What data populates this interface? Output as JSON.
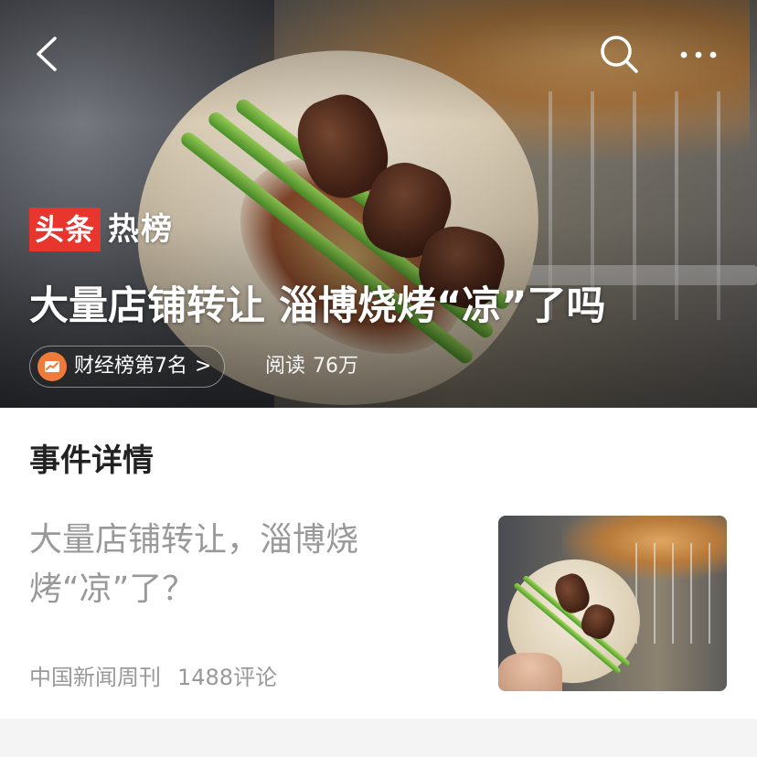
{
  "nav": {
    "back_icon": "chevron-left-icon",
    "search_icon": "search-icon",
    "more_icon": "more-horizontal-icon"
  },
  "hero": {
    "brand_red": "头条",
    "brand_white": "热榜",
    "title": "大量店铺转让 淄博烧烤“凉”了吗",
    "rank_label": "财经榜第7名",
    "rank_arrow": ">",
    "read_label": "阅读",
    "read_value": "76万"
  },
  "detail": {
    "section_title": "事件详情",
    "article": {
      "title": "大量店铺转让，淄博烧烤“凉”了？",
      "source": "中国新闻周刊",
      "comments": "1488评论"
    }
  },
  "colors": {
    "brand_red": "#e8352e",
    "rank_icon_orange": "#f07a3a",
    "muted_text": "#999999",
    "heading_text": "#222222"
  }
}
